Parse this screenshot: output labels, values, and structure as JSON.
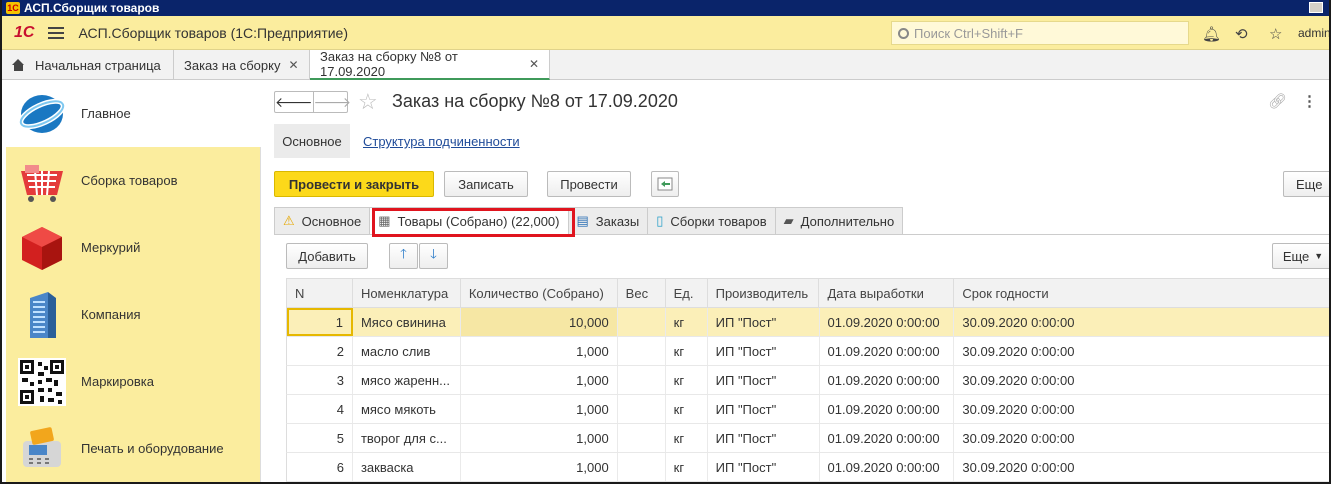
{
  "window": {
    "title": "АСП.Сборщик товаров"
  },
  "appbar": {
    "brand": "1С",
    "title": "АСП.Сборщик товаров  (1С:Предприятие)",
    "search_placeholder": "Поиск Ctrl+Shift+F",
    "user": "admin"
  },
  "tabs": [
    {
      "label": "Начальная страница",
      "closable": false
    },
    {
      "label": "Заказ на сборку",
      "closable": true
    },
    {
      "label": "Заказ на сборку №8 от 17.09.2020",
      "closable": true,
      "active": true
    }
  ],
  "sidebar": {
    "items": [
      {
        "label": "Главное",
        "icon": "globe-icon",
        "active": true
      },
      {
        "label": "Сборка товаров",
        "icon": "basket-icon"
      },
      {
        "label": "Меркурий",
        "icon": "cube-icon"
      },
      {
        "label": "Компания",
        "icon": "building-icon"
      },
      {
        "label": "Маркировка",
        "icon": "qr-code-icon"
      },
      {
        "label": "Печать и оборудование",
        "icon": "card-terminal-icon"
      }
    ]
  },
  "form": {
    "title": "Заказ на сборку №8 от 17.09.2020",
    "subtab_main": "Основное",
    "subtab_link": "Структура подчиненности",
    "buttons": {
      "post_close": "Провести и закрыть",
      "save": "Записать",
      "post": "Провести",
      "more": "Еще",
      "more_grid": "Еще",
      "add": "Добавить"
    },
    "form_tabs": [
      {
        "label": "Основное",
        "icon": "warning-icon"
      },
      {
        "label": "Товары (Собрано) (22,000)",
        "icon": "building-icon",
        "active": true
      },
      {
        "label": "Заказы",
        "icon": "orders-icon"
      },
      {
        "label": "Сборки товаров",
        "icon": "phone-icon"
      },
      {
        "label": "Дополнительно",
        "icon": "comment-icon"
      }
    ]
  },
  "table": {
    "columns": [
      "N",
      "Номенклатура",
      "Количество (Собрано)",
      "Вес",
      "Ед.",
      "Производитель",
      "Дата выработки",
      "Срок годности"
    ],
    "rows": [
      {
        "n": "1",
        "name": "Мясо свинина",
        "qty": "10,000",
        "weight": "",
        "unit": "кг",
        "maker": "ИП \"Пост\"",
        "made": "01.09.2020 0:00:00",
        "expires": "30.09.2020 0:00:00"
      },
      {
        "n": "2",
        "name": "масло слив",
        "qty": "1,000",
        "weight": "",
        "unit": "кг",
        "maker": "ИП \"Пост\"",
        "made": "01.09.2020 0:00:00",
        "expires": "30.09.2020 0:00:00"
      },
      {
        "n": "3",
        "name": "мясо жаренн...",
        "qty": "1,000",
        "weight": "",
        "unit": "кг",
        "maker": "ИП \"Пост\"",
        "made": "01.09.2020 0:00:00",
        "expires": "30.09.2020 0:00:00"
      },
      {
        "n": "4",
        "name": "мясо мякоть",
        "qty": "1,000",
        "weight": "",
        "unit": "кг",
        "maker": "ИП \"Пост\"",
        "made": "01.09.2020 0:00:00",
        "expires": "30.09.2020 0:00:00"
      },
      {
        "n": "5",
        "name": "творог для с...",
        "qty": "1,000",
        "weight": "",
        "unit": "кг",
        "maker": "ИП \"Пост\"",
        "made": "01.09.2020 0:00:00",
        "expires": "30.09.2020 0:00:00"
      },
      {
        "n": "6",
        "name": "закваска",
        "qty": "1,000",
        "weight": "",
        "unit": "кг",
        "maker": "ИП \"Пост\"",
        "made": "01.09.2020 0:00:00",
        "expires": "30.09.2020 0:00:00"
      }
    ]
  },
  "colors": {
    "accent_yellow": "#fcd91a",
    "sidebar_bg": "#fbed9e",
    "highlight_red": "#e0141e",
    "active_tab_green": "#3f9a5a"
  }
}
